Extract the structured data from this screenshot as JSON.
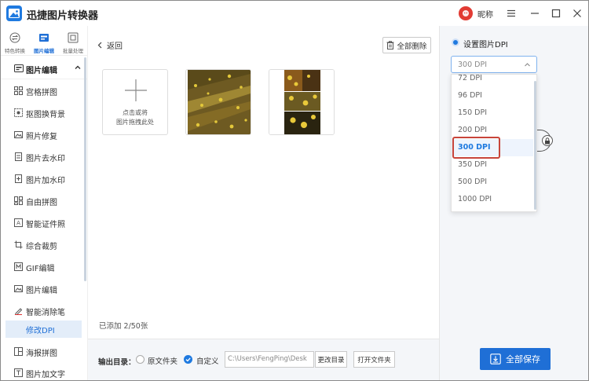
{
  "app": {
    "title": "迅捷图片转换器",
    "username": "昵称",
    "colors": {
      "accent": "#1f7ae0",
      "primary_button": "#1f6fd6",
      "highlight_border": "#c8453a"
    }
  },
  "topnav": [
    {
      "label": "特色转换",
      "icon": "convert-icon",
      "active": false
    },
    {
      "label": "图片编辑",
      "icon": "image-edit-icon",
      "active": true
    },
    {
      "label": "批量处理",
      "icon": "batch-icon",
      "active": false
    }
  ],
  "sidebar": {
    "section_label": "图片编辑",
    "items": [
      {
        "label": "宫格拼图",
        "icon": "grid-icon"
      },
      {
        "label": "抠图换背景",
        "icon": "cutout-icon"
      },
      {
        "label": "照片修复",
        "icon": "photo-repair-icon"
      },
      {
        "label": "图片去水印",
        "icon": "remove-watermark-icon"
      },
      {
        "label": "图片加水印",
        "icon": "add-watermark-icon"
      },
      {
        "label": "自由拼图",
        "icon": "free-collage-icon"
      },
      {
        "label": "智能证件照",
        "icon": "id-photo-icon"
      },
      {
        "label": "综合裁剪",
        "icon": "crop-icon"
      },
      {
        "label": "GIF编辑",
        "icon": "gif-icon"
      },
      {
        "label": "图片编辑",
        "icon": "edit-icon"
      },
      {
        "label": "智能消除笔",
        "icon": "eraser-pen-icon"
      },
      {
        "label": "修改DPI",
        "icon": "dpi-icon",
        "active": true
      },
      {
        "label": "海报拼图",
        "icon": "poster-icon"
      },
      {
        "label": "图片加文字",
        "icon": "add-text-icon"
      }
    ]
  },
  "main": {
    "back_label": "返回",
    "delete_all_label": "全部删除",
    "add_tile": {
      "line1": "点击或将",
      "line2": "图片拖拽此处"
    },
    "count_text": "已添加 2/50张"
  },
  "output": {
    "label": "输出目录：",
    "option_original": "原文件夹",
    "option_custom": "自定义",
    "path_value": "C:\\Users\\FengPing\\Desk",
    "change_dir_label": "更改目录",
    "open_folder_label": "打开文件夹"
  },
  "dpi": {
    "title": "设置图片DPI",
    "current_value": "300 DPI",
    "options": [
      "72 DPI",
      "96 DPI",
      "150 DPI",
      "200 DPI",
      "300 DPI",
      "350 DPI",
      "500 DPI",
      "1000 DPI"
    ],
    "selected_index": 4
  },
  "save_all_label": "全部保存"
}
